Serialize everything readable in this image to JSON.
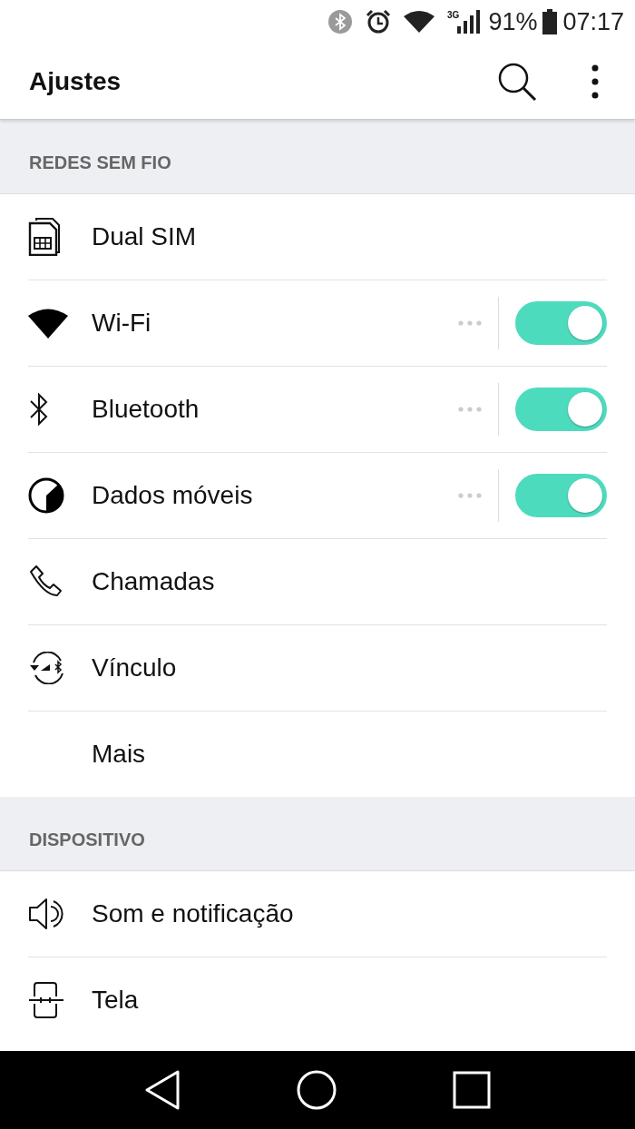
{
  "status_bar": {
    "network": "3G",
    "battery": "91%",
    "time": "07:17"
  },
  "app_bar": {
    "title": "Ajustes"
  },
  "sections": [
    {
      "header": "REDES SEM FIO",
      "items": [
        {
          "label": "Dual SIM",
          "kind": "link"
        },
        {
          "label": "Wi-Fi",
          "kind": "toggle",
          "on": true
        },
        {
          "label": "Bluetooth",
          "kind": "toggle",
          "on": true
        },
        {
          "label": "Dados móveis",
          "kind": "toggle",
          "on": true
        },
        {
          "label": "Chamadas",
          "kind": "link"
        },
        {
          "label": "Vínculo",
          "kind": "link"
        },
        {
          "label": "Mais",
          "kind": "link"
        }
      ]
    },
    {
      "header": "DISPOSITIVO",
      "items": [
        {
          "label": "Som e notificação",
          "kind": "link"
        },
        {
          "label": "Tela",
          "kind": "link"
        }
      ]
    }
  ]
}
